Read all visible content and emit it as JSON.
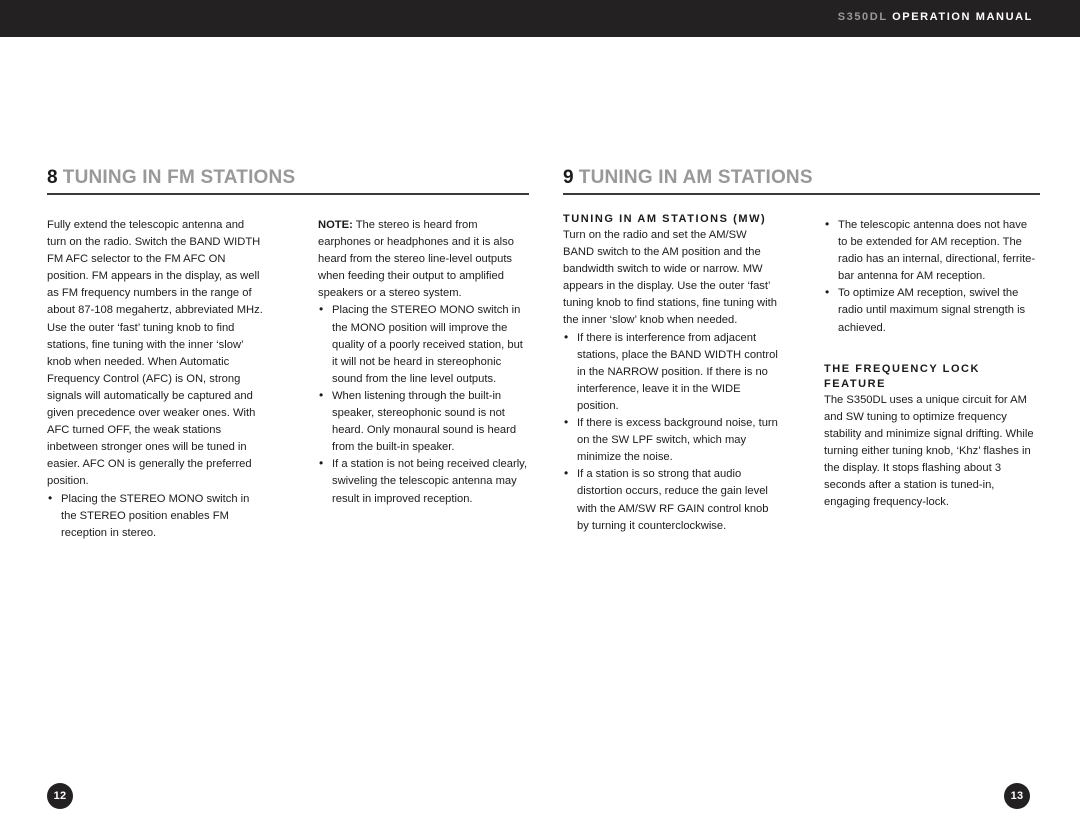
{
  "header": {
    "model": "S350DL",
    "title": "OPERATION MANUAL"
  },
  "colors": {
    "header_bg": "#232122",
    "heading_gray": "#9a989a",
    "heading_number": "#1a1a1a",
    "body_text": "#1c1c1c",
    "rule": "#3a3a3a"
  },
  "left_page": {
    "section_number": "8",
    "section_title": "TUNING IN FM STATIONS",
    "page_number": "12",
    "column_1": {
      "intro": "Fully extend the telescopic antenna and turn on the radio. Switch the BAND WIDTH FM AFC selector to the FM AFC ON position. FM appears in the display, as well as FM frequency numbers in the range of about 87-108 megahertz, abbreviated MHz. Use the outer ‘fast’ tuning knob to find stations, fine tuning with the inner ‘slow’ knob when needed. When Automatic Frequency Control (AFC) is ON, strong signals will automatically be captured and given precedence over weaker ones. With AFC turned OFF, the weak stations inbetween stronger ones will be tuned in easier. AFC ON is generally the preferred position.",
      "bullet_1": "Placing the STEREO MONO switch in the STEREO position enables FM reception in stereo."
    },
    "column_2": {
      "note_label": "NOTE:",
      "note_text": " The stereo is heard from earphones or headphones and it is also heard from the stereo line-level outputs when feeding their output to amplified speakers or a stereo system.",
      "bullet_1": "Placing the STEREO MONO switch in the MONO position will improve the quality of a poorly received station, but it will not be heard in stereophonic sound from the line level outputs.",
      "bullet_2": "When listening through the built-in speaker, stereophonic sound is not heard. Only monaural sound is heard from the built-in speaker.",
      "bullet_3": "If a station is not being received clearly, swiveling the telescopic antenna may result in improved reception."
    }
  },
  "right_page": {
    "section_number": "9",
    "section_title": "TUNING IN AM STATIONS",
    "page_number": "13",
    "column_3": {
      "sub_heading": "TUNING IN AM STATIONS (MW)",
      "intro": "Turn on the radio and set the AM/SW BAND switch to the AM position and the bandwidth switch to wide or narrow. MW appears in the display. Use the outer ‘fast’ tuning knob to find stations, fine tuning with the inner ‘slow’ knob when needed.",
      "bullet_1": "If there is interference from adjacent stations, place the BAND WIDTH control in the NARROW position. If there is no interference, leave it in the WIDE position.",
      "bullet_2": "If there is excess background noise, turn on the SW LPF switch, which may minimize the noise.",
      "bullet_3": "If a station is so strong that audio distortion occurs, reduce the gain level with the AM/SW RF GAIN control knob by turning it counterclockwise."
    },
    "column_4": {
      "bullet_1": "The telescopic antenna does not have to be extended for AM reception. The radio has an internal, directional, ferrite-bar antenna for AM reception.",
      "bullet_2": "To optimize AM reception, swivel the radio until maximum signal strength is achieved.",
      "sub_heading_line_1": "THE FREQUENCY LOCK",
      "sub_heading_line_2": "FEATURE",
      "body": "The S350DL uses a unique circuit for AM and SW tuning to optimize frequency stability and minimize signal drifting. While turning either tuning knob, ‘Khz’ flashes in the display. It stops flashing about 3 seconds after a station is tuned-in, engaging frequency-lock."
    }
  }
}
